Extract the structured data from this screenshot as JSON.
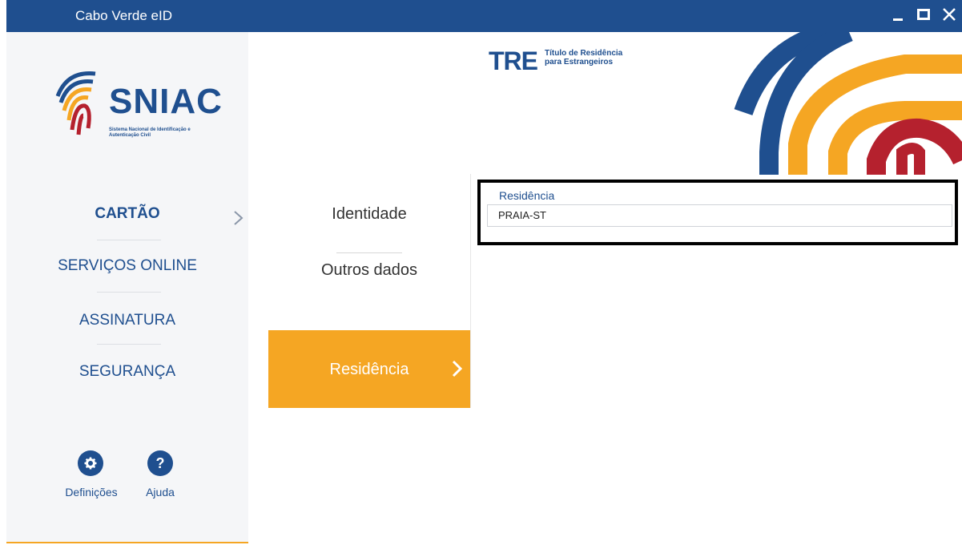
{
  "window": {
    "title": "Cabo Verde eID",
    "minimize_icon": "minimize-icon",
    "maximize_icon": "maximize-icon",
    "close_icon": "close-icon",
    "close_glyph": "✕"
  },
  "brand": {
    "logo_text": "SNIAC",
    "logo_subtitle": "Sistema Nacional de Identificação e Autenticação Civil",
    "colors": {
      "blue": "#1f4f8f",
      "orange": "#f5a623",
      "red": "#b5212e"
    }
  },
  "sidebar": {
    "items": [
      {
        "label": "CARTÃO",
        "active": true
      },
      {
        "label": "SERVIÇOS ONLINE",
        "active": false
      },
      {
        "label": "ASSINATURA",
        "active": false
      },
      {
        "label": "SEGURANÇA",
        "active": false
      }
    ],
    "settings": {
      "label": "Definições",
      "icon": "gear-icon"
    },
    "help": {
      "label": "Ajuda",
      "icon": "question-icon",
      "glyph": "?"
    }
  },
  "card_type": {
    "abbr": "TRE",
    "line1": "Título de Residência",
    "line2": "para Estrangeiros"
  },
  "subtabs": [
    {
      "label": "Identidade",
      "active": false
    },
    {
      "label": "Outros dados",
      "active": false
    },
    {
      "label": "Residência",
      "active": true
    }
  ],
  "residence": {
    "label": "Residência",
    "value": "PRAIA-ST"
  }
}
